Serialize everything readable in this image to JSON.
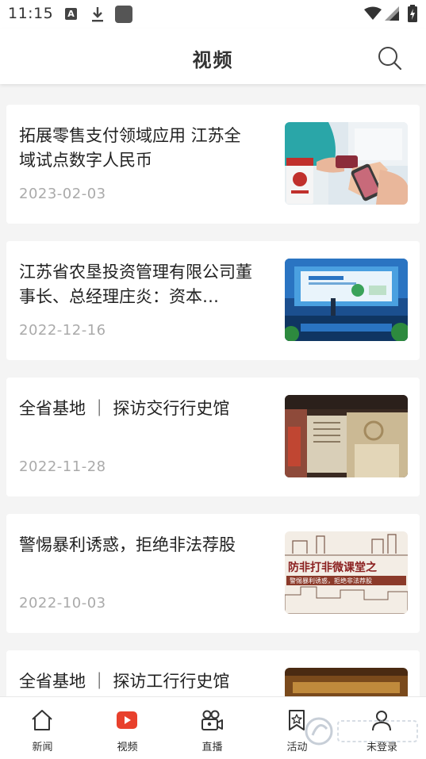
{
  "status_bar": {
    "time": "11:15",
    "icons": [
      "text-a-icon",
      "download-icon",
      "app-icon",
      "wifi-icon",
      "signal-icon",
      "battery-icon"
    ]
  },
  "header": {
    "title": "视频",
    "search_icon": "search-icon"
  },
  "news": [
    {
      "title": "拓展零售支付领域应用 江苏全域试点数字人民币",
      "date": "2023-02-03",
      "thumbnail": "digital-rmb-payment-photo"
    },
    {
      "title": "江苏省农垦投资管理有限公司董事长、总经理庄炎：资本…",
      "date": "2022-12-16",
      "thumbnail": "conference-stage-photo"
    },
    {
      "title": "全省基地 ｜ 探访交行行史馆",
      "date": "2022-11-28",
      "thumbnail": "museum-hall-photo"
    },
    {
      "title": "警惕暴利诱惑，拒绝非法荐股",
      "date": "2022-10-03",
      "thumbnail": "anti-fraud-class-banner"
    },
    {
      "title": "全省基地 ｜ 探访工行行史馆",
      "date": "",
      "thumbnail": "bank-history-hall-photo"
    }
  ],
  "thumb_texts": {
    "banner_main": "防非打非微课堂之",
    "banner_sub": "警惕暴利诱惑，拒绝非法荐股"
  },
  "bottom_nav": [
    {
      "label": "新闻",
      "icon": "home-icon",
      "active": false
    },
    {
      "label": "视频",
      "icon": "video-play-icon",
      "active": true
    },
    {
      "label": "直播",
      "icon": "camera-icon",
      "active": false
    },
    {
      "label": "活动",
      "icon": "bookmark-star-icon",
      "active": false
    },
    {
      "label": "未登录",
      "icon": "user-icon",
      "active": false
    }
  ],
  "colors": {
    "accent": "#e8402c",
    "text": "#222222",
    "date": "#aaaaaa",
    "background": "#f4f4f4"
  }
}
